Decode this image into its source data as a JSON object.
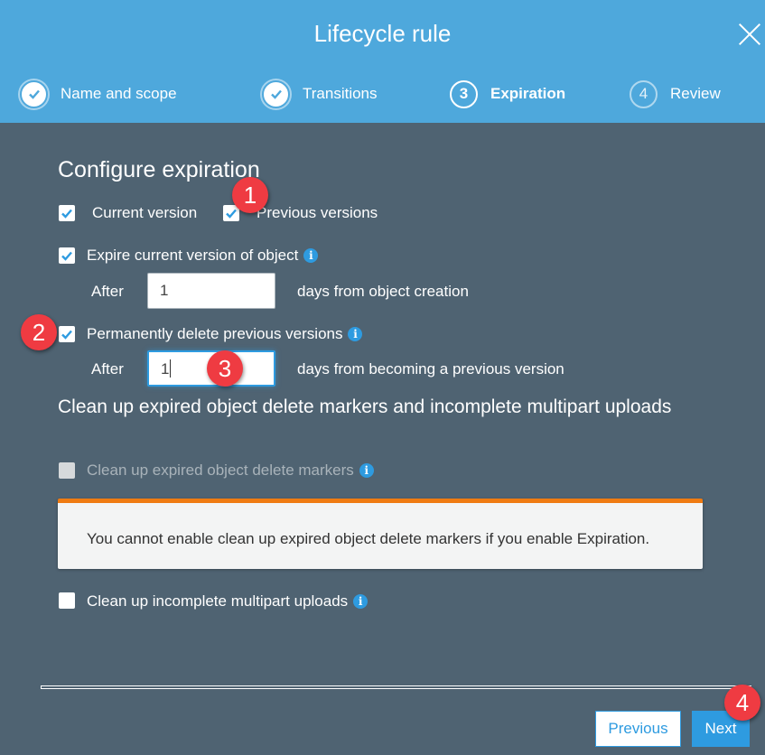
{
  "header": {
    "title": "Lifecycle rule",
    "close_icon": "close-icon",
    "steps": [
      {
        "number": "1",
        "label": "Name and scope",
        "state": "done"
      },
      {
        "number": "2",
        "label": "Transitions",
        "state": "done"
      },
      {
        "number": "3",
        "label": "Expiration",
        "state": "active"
      },
      {
        "number": "4",
        "label": "Review",
        "state": "future"
      }
    ]
  },
  "configure": {
    "heading": "Configure expiration",
    "current_version": {
      "label": "Current version",
      "checked": true
    },
    "previous_versions": {
      "label": "Previous versions",
      "checked": true
    },
    "expire_current": {
      "label": "Expire current version of object",
      "checked": true,
      "after_label": "After",
      "value": "1",
      "suffix": "days from object creation"
    },
    "delete_previous": {
      "label": "Permanently delete previous versions",
      "checked": true,
      "after_label": "After",
      "value": "1",
      "suffix": "days from becoming a previous version"
    }
  },
  "cleanup": {
    "heading": "Clean up expired object delete markers and incomplete multipart uploads",
    "delete_markers": {
      "label": "Clean up expired object delete markers",
      "checked": false,
      "disabled": true
    },
    "alert": "You cannot enable clean up expired object delete markers if you enable Expiration.",
    "multipart": {
      "label": "Clean up incomplete multipart uploads",
      "checked": false
    }
  },
  "footer": {
    "previous_label": "Previous",
    "next_label": "Next"
  },
  "annotations": [
    "1",
    "2",
    "3",
    "4"
  ],
  "colors": {
    "header": "#4ea8dc",
    "body": "#4f6372",
    "accent": "#2e9be0",
    "warning": "#ef7b12",
    "badge": "#ef3b42"
  }
}
